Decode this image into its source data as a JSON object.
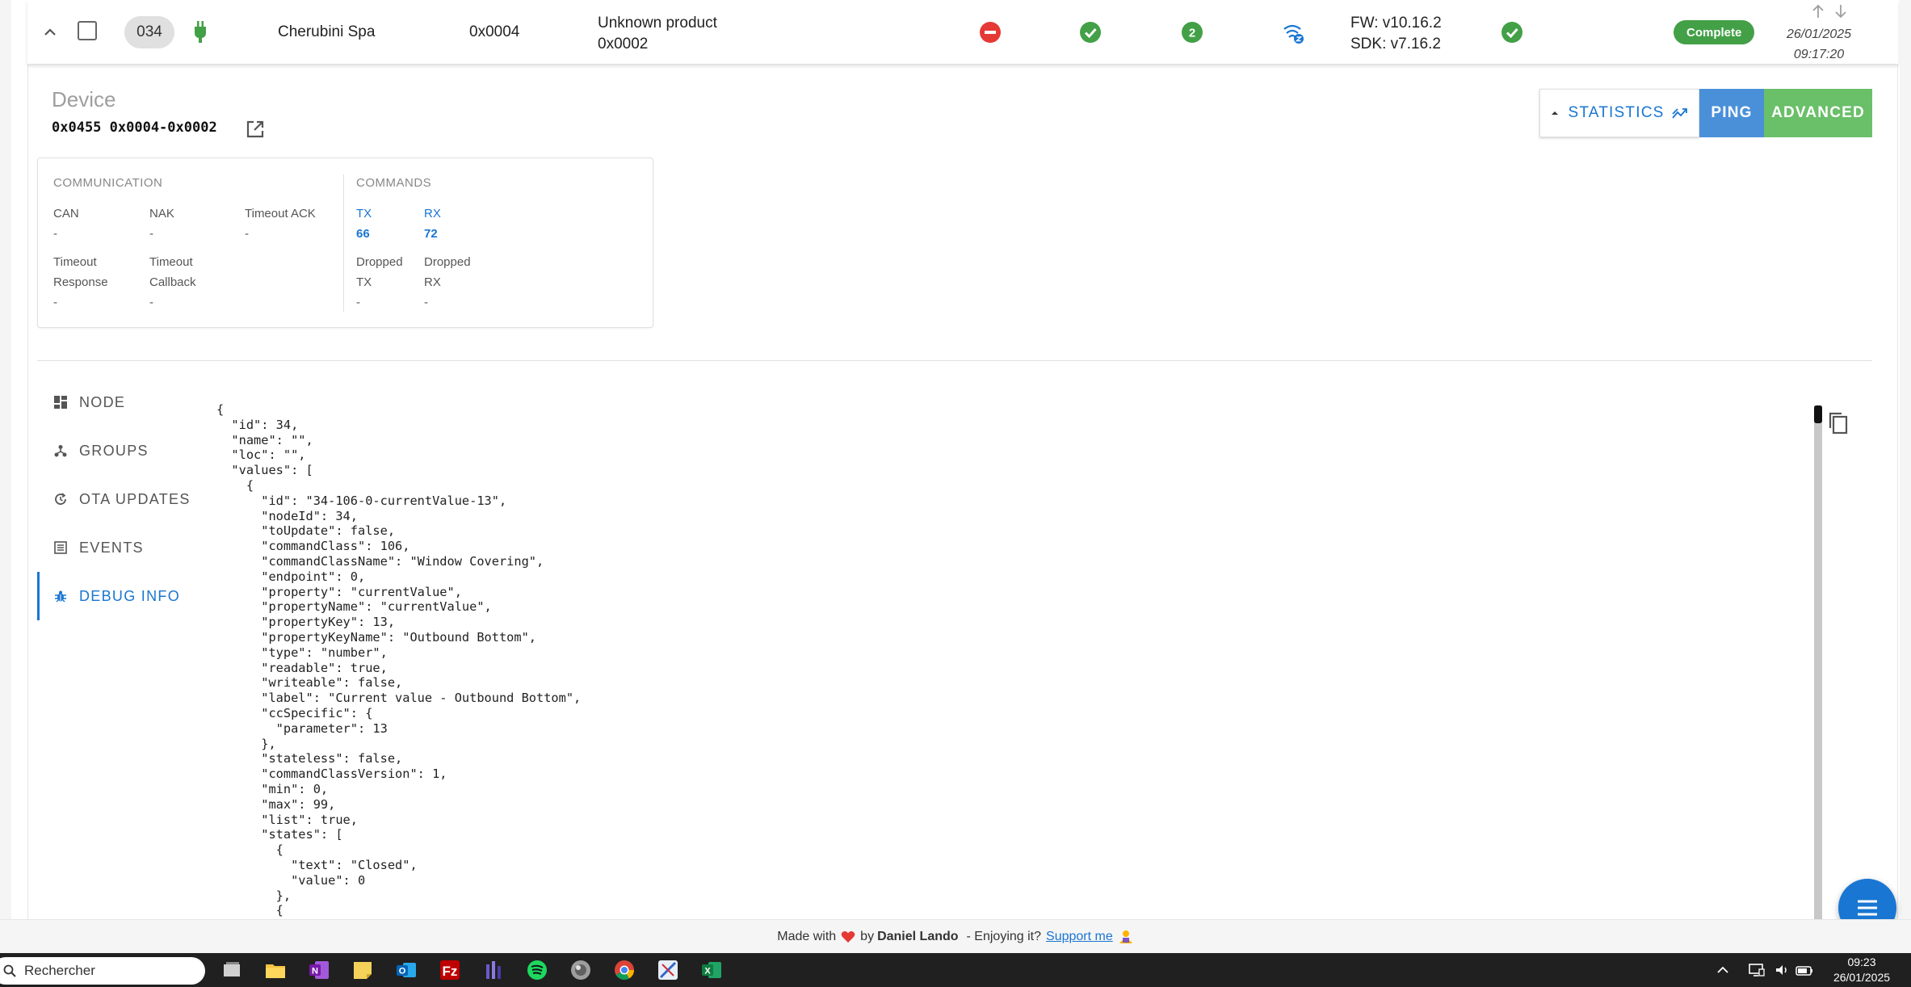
{
  "node": {
    "id": "034",
    "manufacturer": "Cherubini Spa",
    "product_id": "0x0004",
    "product_line1": "Unknown product",
    "product_line2": "0x0002",
    "fw": "FW: v10.16.2",
    "sdk": "SDK: v7.16.2",
    "interview": "Complete",
    "date": "26/01/2025",
    "time": "09:17:20",
    "security_badge": "2",
    "colors": {
      "green": "#43a047",
      "red": "#e53935",
      "blue": "#1976d2"
    }
  },
  "device": {
    "title": "Device",
    "id_string": "0x0455 0x0004-0x0002"
  },
  "buttons": {
    "statistics": "STATISTICS",
    "ping": "PING",
    "advanced": "ADVANCED"
  },
  "stats": {
    "communication_title": "COMMUNICATION",
    "commands_title": "COMMANDS",
    "can_label": "CAN",
    "can_value": "-",
    "nak_label": "NAK",
    "nak_value": "-",
    "timeout_ack_label": "Timeout ACK",
    "timeout_ack_value": "-",
    "timeout_response_label1": "Timeout",
    "timeout_response_label2": "Response",
    "timeout_response_value": "-",
    "timeout_callback_label1": "Timeout",
    "timeout_callback_label2": "Callback",
    "timeout_callback_value": "-",
    "tx_label": "TX",
    "tx_value": "66",
    "rx_label": "RX",
    "rx_value": "72",
    "dropped_tx_label1": "Dropped",
    "dropped_tx_label2": "TX",
    "dropped_tx_value": "-",
    "dropped_rx_label1": "Dropped",
    "dropped_rx_label2": "RX",
    "dropped_rx_value": "-"
  },
  "tabs": [
    {
      "label": "NODE",
      "icon": "dashboard-icon"
    },
    {
      "label": "GROUPS",
      "icon": "groups-icon"
    },
    {
      "label": "OTA UPDATES",
      "icon": "update-icon"
    },
    {
      "label": "EVENTS",
      "icon": "list-icon"
    },
    {
      "label": "DEBUG INFO",
      "icon": "bug-icon",
      "active": true
    }
  ],
  "debug_json": "{\n  \"id\": 34,\n  \"name\": \"\",\n  \"loc\": \"\",\n  \"values\": [\n    {\n      \"id\": \"34-106-0-currentValue-13\",\n      \"nodeId\": 34,\n      \"toUpdate\": false,\n      \"commandClass\": 106,\n      \"commandClassName\": \"Window Covering\",\n      \"endpoint\": 0,\n      \"property\": \"currentValue\",\n      \"propertyName\": \"currentValue\",\n      \"propertyKey\": 13,\n      \"propertyKeyName\": \"Outbound Bottom\",\n      \"type\": \"number\",\n      \"readable\": true,\n      \"writeable\": false,\n      \"label\": \"Current value - Outbound Bottom\",\n      \"ccSpecific\": {\n        \"parameter\": 13\n      },\n      \"stateless\": false,\n      \"commandClassVersion\": 1,\n      \"min\": 0,\n      \"max\": 99,\n      \"list\": true,\n      \"states\": [\n        {\n          \"text\": \"Closed\",\n          \"value\": 0\n        },\n        {",
  "footer": {
    "made_with": "Made with",
    "by": "by",
    "author": "Daniel Lando",
    "enjoying": "- Enjoying it?",
    "support": "Support me"
  },
  "taskbar": {
    "search_placeholder": "Rechercher",
    "time": "09:23",
    "date": "26/01/2025"
  }
}
